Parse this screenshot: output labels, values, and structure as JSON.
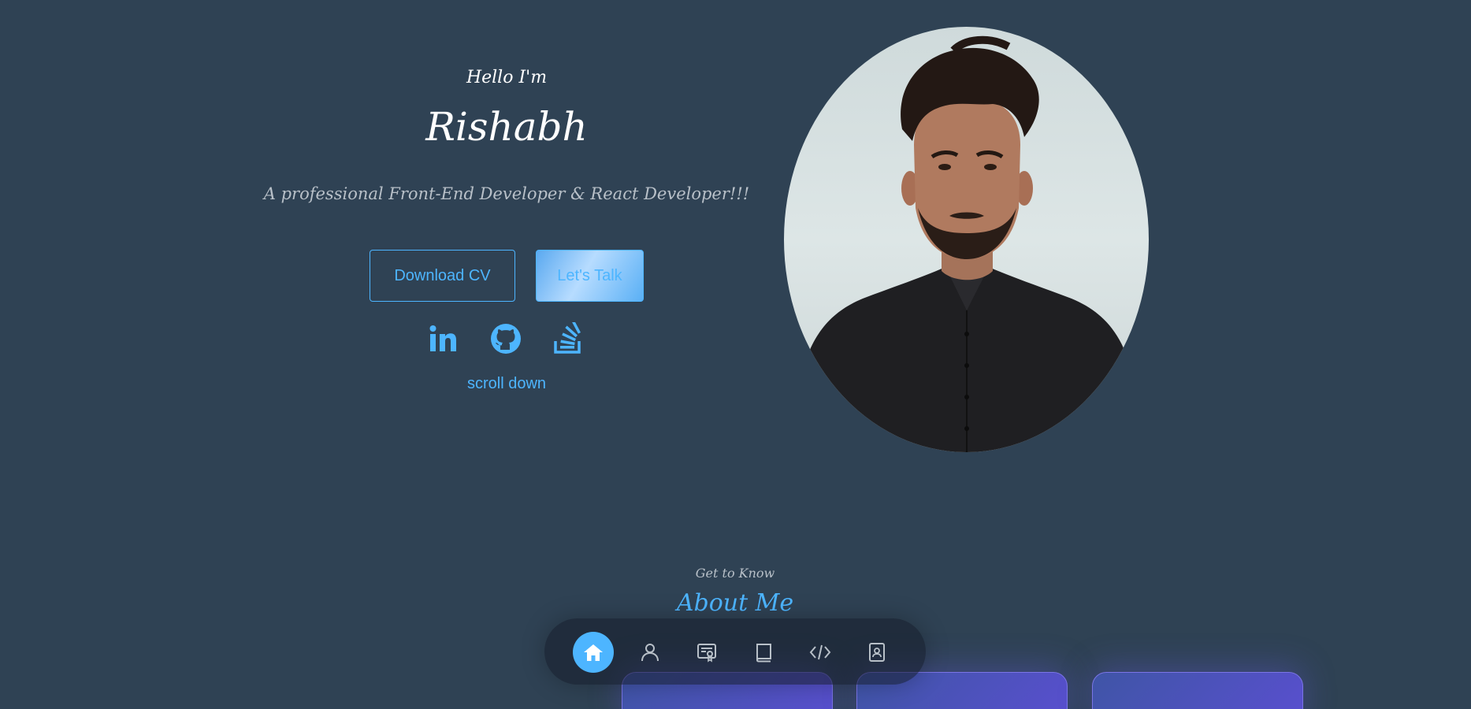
{
  "hero": {
    "greeting": "Hello I'm",
    "name": "Rishabh",
    "tagline": "A professional Front-End Developer & React Developer!!!",
    "download_cv_label": "Download CV",
    "lets_talk_label": "Let's Talk",
    "scroll_label": "scroll down"
  },
  "socials": [
    {
      "icon": "linkedin-icon"
    },
    {
      "icon": "github-icon"
    },
    {
      "icon": "stackoverflow-icon"
    }
  ],
  "about": {
    "kicker": "Get to Know",
    "title": "About Me"
  },
  "nav": {
    "active": "home",
    "items": [
      "home-icon",
      "user-icon",
      "certificate-icon",
      "book-icon",
      "code-icon",
      "contact-icon"
    ]
  },
  "colors": {
    "background": "#2f4254",
    "accent": "#4db5ff",
    "card_gradient": [
      "#3f55a6",
      "#5a4fd0"
    ]
  }
}
